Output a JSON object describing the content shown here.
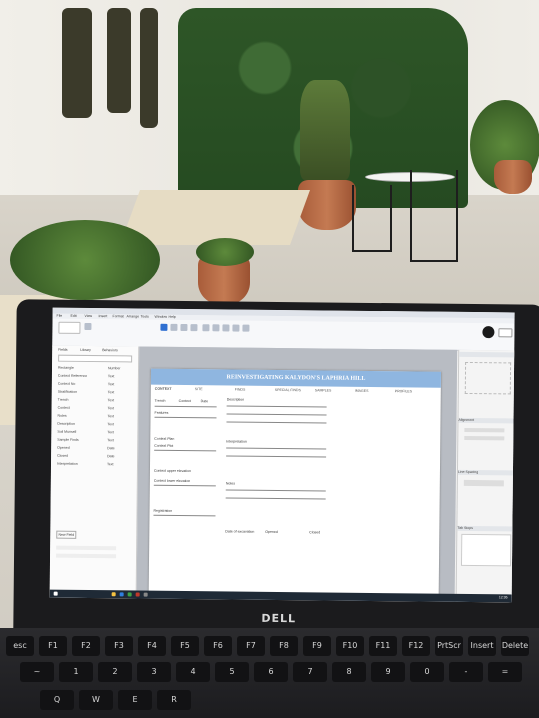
{
  "application": {
    "title_bar": "",
    "menu": [
      "File",
      "Edit",
      "View",
      "Insert",
      "Format",
      "Arrange",
      "Tools",
      "Window",
      "Help"
    ]
  },
  "document": {
    "header": "REINVESTIGATING KALYDON'S LAPHRIA HILL",
    "tabs": [
      "CONTEXT",
      "SITE",
      "FINDS",
      "SPECIAL FINDS",
      "SAMPLES",
      "IMAGES",
      "PROFILES"
    ],
    "left_fields": [
      "Trench",
      "Context",
      "Date",
      "Features",
      "Context Plan",
      "Context Plot",
      "Context upper elevation",
      "Context lower elevation",
      "Registration"
    ],
    "right_fields": [
      "Description",
      "Interpretation",
      "Notes"
    ],
    "footer_fields": [
      "Date of excavation",
      "Opened",
      "Closed"
    ]
  },
  "sidebar": {
    "tabs": [
      "Fields",
      "Library",
      "Behaviors"
    ],
    "items": [
      {
        "name": "Rectangle",
        "type": "Number"
      },
      {
        "name": "Context Reference",
        "type": "Text"
      },
      {
        "name": "Context No",
        "type": "Text"
      },
      {
        "name": "Stratification",
        "type": "Text"
      },
      {
        "name": "Trench",
        "type": "Text"
      },
      {
        "name": "Context",
        "type": "Text"
      },
      {
        "name": "Notes",
        "type": "Text"
      },
      {
        "name": "Description",
        "type": "Text"
      },
      {
        "name": "Soil Munsell",
        "type": "Text"
      },
      {
        "name": "Sample Finds",
        "type": "Text"
      },
      {
        "name": "Opened",
        "type": "Date"
      },
      {
        "name": "Closed",
        "type": "Date"
      },
      {
        "name": "Interpretation",
        "type": "Text"
      }
    ],
    "footer_button": "New Field"
  },
  "right_panel": {
    "sections": [
      "Alignment",
      "Line Spacing",
      "Tab Stops"
    ],
    "clock": "12:05"
  },
  "laptop": {
    "brand": "DELL"
  },
  "keyboard": {
    "row1": [
      "esc",
      "F1",
      "F2",
      "F3",
      "F4",
      "F5",
      "F6",
      "F7",
      "F8",
      "F9",
      "F10",
      "F11",
      "F12",
      "PrtScr",
      "Insert",
      "Delete"
    ],
    "row2": [
      "~",
      "1",
      "2",
      "3",
      "4",
      "5",
      "6",
      "7",
      "8",
      "9",
      "0",
      "-",
      "="
    ],
    "row3": [
      "Q",
      "W",
      "E",
      "R"
    ]
  }
}
